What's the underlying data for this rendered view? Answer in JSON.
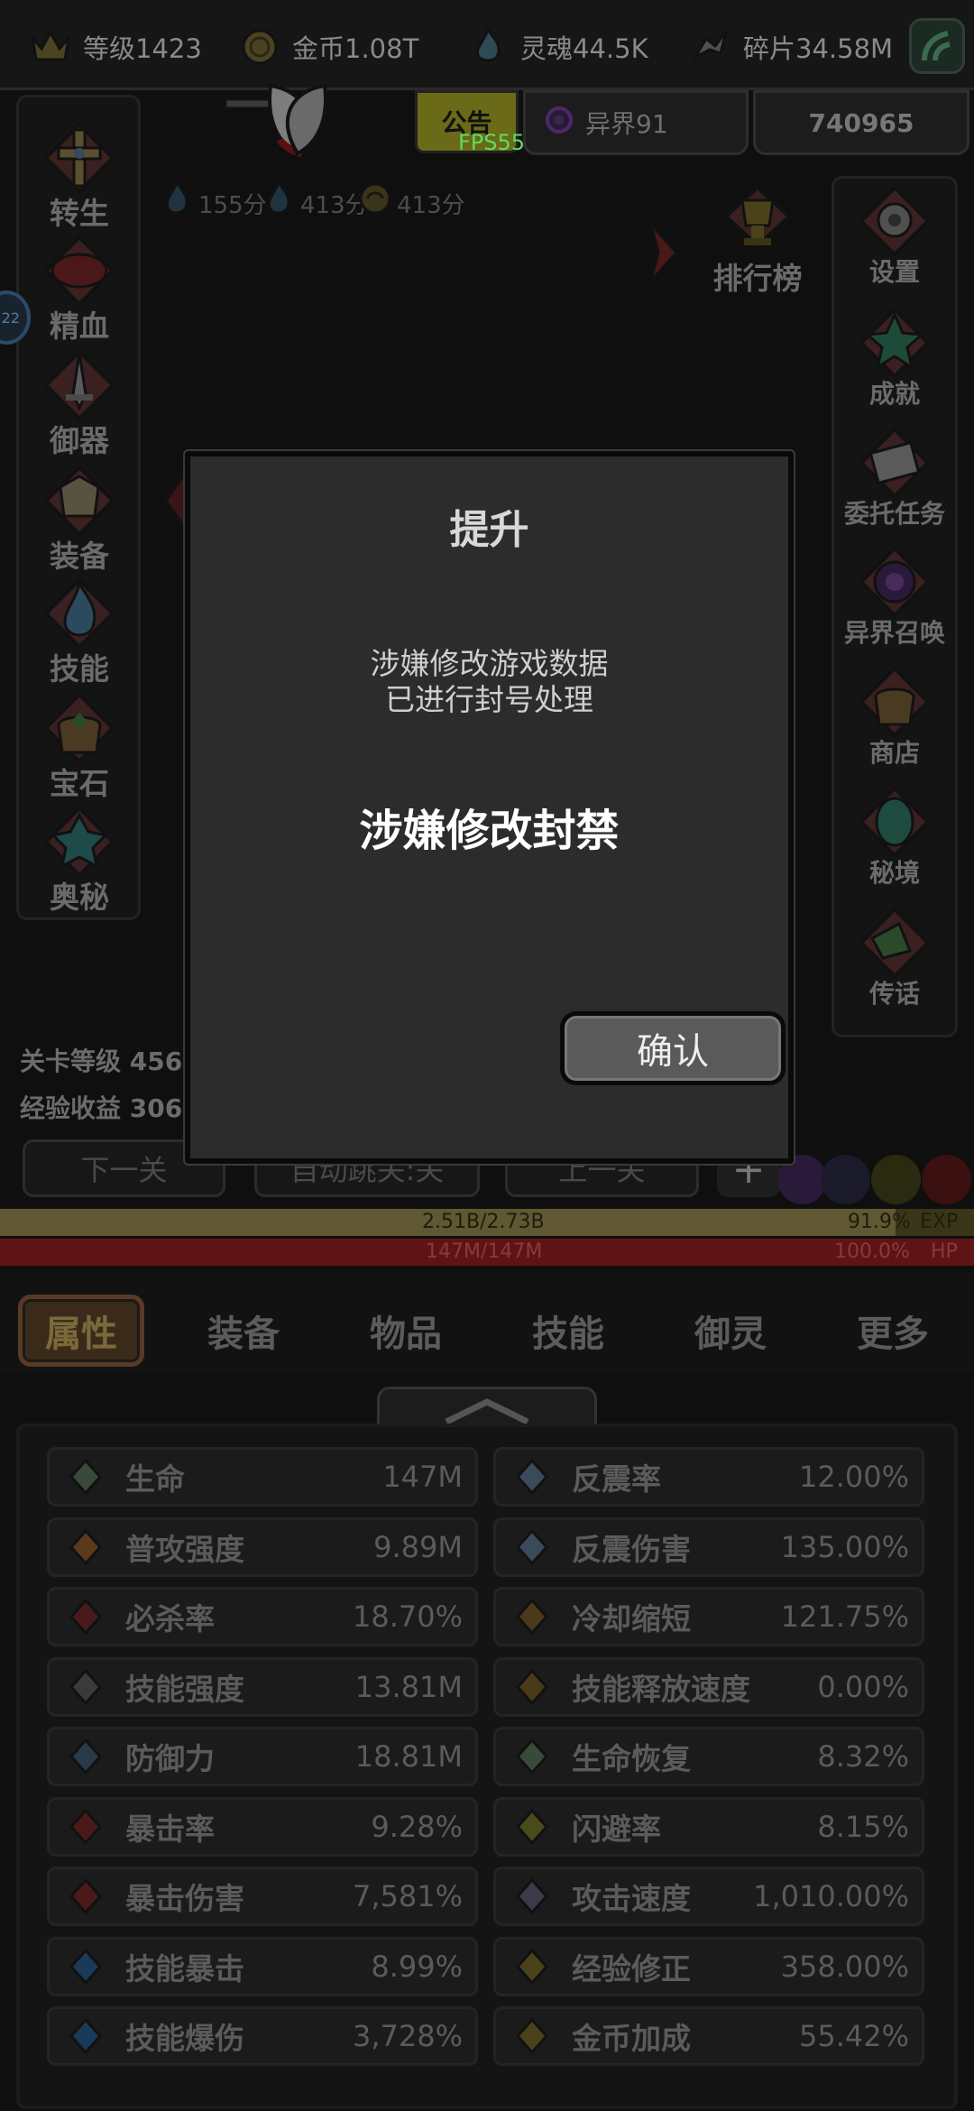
{
  "topbar": {
    "level": "等级1423",
    "gold": "金币1.08T",
    "soul": "灵魂44.5K",
    "shard": "碎片34.58M"
  },
  "row2": {
    "announcement": "公告",
    "fps": "FPS55",
    "otherworld": "异界91",
    "power": "740965"
  },
  "scores": [
    "155分",
    "413分",
    "413分"
  ],
  "left_nav": [
    {
      "label": "转生",
      "icon": "rebirth-icon"
    },
    {
      "label": "精血",
      "icon": "blood-icon"
    },
    {
      "label": "御器",
      "icon": "weapon-icon"
    },
    {
      "label": "装备",
      "icon": "equipment-icon"
    },
    {
      "label": "技能",
      "icon": "skill-flame-icon"
    },
    {
      "label": "宝石",
      "icon": "gem-bag-icon"
    },
    {
      "label": "奥秘",
      "icon": "arcane-icon"
    }
  ],
  "ranking": {
    "label": "排行榜"
  },
  "bubble_text": "22",
  "right_nav": [
    {
      "label": "设置",
      "icon": "settings-gear-icon"
    },
    {
      "label": "成就",
      "icon": "achievement-star-icon"
    },
    {
      "label": "委托任务",
      "icon": "quest-icon"
    },
    {
      "label": "异界召唤",
      "icon": "summon-portal-icon"
    },
    {
      "label": "商店",
      "icon": "shop-bag-icon"
    },
    {
      "label": "秘境",
      "icon": "secret-realm-icon"
    },
    {
      "label": "传话",
      "icon": "horn-icon"
    }
  ],
  "stage": {
    "level_label": "关卡等级 456",
    "exp_label": "经验收益 306"
  },
  "buttons": {
    "next": "下一关",
    "auto": "自动跳关:关",
    "prev": "上一关",
    "plus": "+"
  },
  "exp": {
    "text": "2.51B/2.73B",
    "percent": "91.9%",
    "tag": "EXP",
    "fraction": 0.919
  },
  "hp": {
    "text": "147M/147M",
    "percent": "100.0%",
    "tag": "HP",
    "fraction": 1.0
  },
  "tabs": [
    "属性",
    "装备",
    "物品",
    "技能",
    "御灵",
    "更多"
  ],
  "active_tab": 0,
  "stats": [
    {
      "name": "生命",
      "value": "147M",
      "icon": "life-cross-icon"
    },
    {
      "name": "反震率",
      "value": "12.00%",
      "icon": "thorns-icon"
    },
    {
      "name": "普攻强度",
      "value": "9.89M",
      "icon": "attack-icon"
    },
    {
      "name": "反震伤害",
      "value": "135.00%",
      "icon": "thorns-damage-icon"
    },
    {
      "name": "必杀率",
      "value": "18.70%",
      "icon": "fatal-icon"
    },
    {
      "name": "冷却缩短",
      "value": "121.75%",
      "icon": "cooldown-icon"
    },
    {
      "name": "技能强度",
      "value": "13.81M",
      "icon": "skill-power-icon"
    },
    {
      "name": "技能释放速度",
      "value": "0.00%",
      "icon": "cast-speed-icon"
    },
    {
      "name": "防御力",
      "value": "18.81M",
      "icon": "shield-icon"
    },
    {
      "name": "生命恢复",
      "value": "8.32%",
      "icon": "regen-icon"
    },
    {
      "name": "暴击率",
      "value": "9.28%",
      "icon": "crit-rate-icon"
    },
    {
      "name": "闪避率",
      "value": "8.15%",
      "icon": "dodge-boot-icon"
    },
    {
      "name": "暴击伤害",
      "value": "7,581%",
      "icon": "crit-damage-icon"
    },
    {
      "name": "攻击速度",
      "value": "1,010.00%",
      "icon": "attack-speed-icon"
    },
    {
      "name": "技能暴击",
      "value": "8.99%",
      "icon": "skill-crit-icon"
    },
    {
      "name": "经验修正",
      "value": "358.00%",
      "icon": "exp-crown-icon"
    },
    {
      "name": "技能爆伤",
      "value": "3,728%",
      "icon": "skill-crit-damage-icon"
    },
    {
      "name": "金币加成",
      "value": "55.42%",
      "icon": "gold-coin-icon"
    }
  ],
  "dialog": {
    "title": "提升",
    "message_line1": "涉嫌修改游戏数据",
    "message_line2": "已进行封号处理",
    "headline": "涉嫌修改封禁",
    "confirm": "确认"
  },
  "colors": {
    "dialog_bg": "#2c2c2c",
    "exp_bar": "#5f5833",
    "hp_bar": "#5e1414",
    "active_tab": "#3a2a1a",
    "fps_text": "#5fdc5f"
  }
}
